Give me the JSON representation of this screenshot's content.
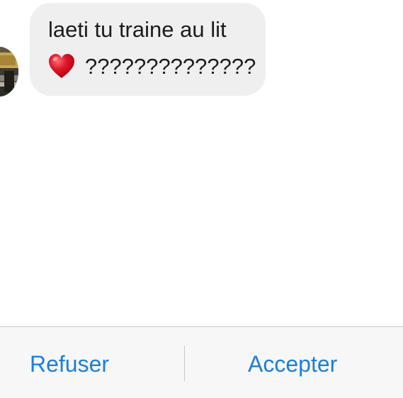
{
  "conversation": {
    "message": {
      "line1": "laeti tu traine au lit",
      "heart_icon": "red-heart-icon",
      "line2_text": "??????????????"
    }
  },
  "request_actions": {
    "refuse_label": "Refuser",
    "accept_label": "Accepter",
    "accent_color": "#1b7fd9"
  },
  "colors": {
    "bubble_background": "#efeff0",
    "footer_background": "#f7f7f7",
    "heart": "#e0162b"
  }
}
